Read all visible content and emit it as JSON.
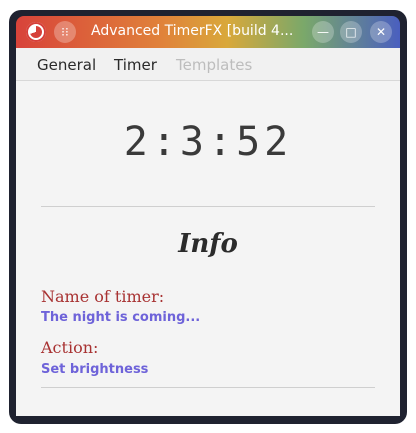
{
  "window": {
    "title": "Advanced TimerFX [build 4...",
    "menu_glyph": "⁝⁝",
    "minimize_glyph": "—",
    "maximize_glyph": "□",
    "close_glyph": "✕"
  },
  "menubar": {
    "items": [
      {
        "label": "General"
      },
      {
        "label": "Timer"
      },
      {
        "label": "Templates",
        "disabled": true
      }
    ]
  },
  "main": {
    "timer_display": "2:3:52",
    "info_heading": "Info",
    "name_label": "Name of timer:",
    "name_value": "The night is coming...",
    "action_label": "Action:",
    "action_value": "Set brightness"
  },
  "colors": {
    "label": "#a83232",
    "value": "#6e63d9",
    "disabled": "#bdbdbd"
  }
}
